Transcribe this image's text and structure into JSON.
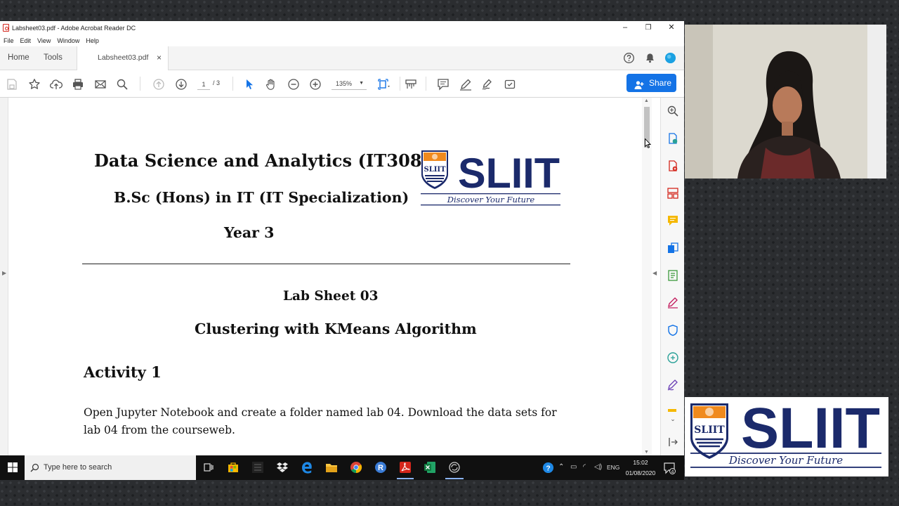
{
  "window": {
    "title": "Labsheet03.pdf - Adobe Acrobat Reader DC",
    "minimize": "–",
    "restore": "❐",
    "close": "✕"
  },
  "menu": [
    "File",
    "Edit",
    "View",
    "Window",
    "Help"
  ],
  "tabs": {
    "home": "Home",
    "tools": "Tools",
    "document": "Labsheet03.pdf",
    "close": "×"
  },
  "toolbar": {
    "page_current": "1",
    "page_total": "/ 3",
    "zoom": "135%",
    "share_label": "Share"
  },
  "document": {
    "course_title": "Data Science and Analytics (IT3080)",
    "degree": "B.Sc (Hons) in IT (IT Specialization)",
    "year": "Year 3",
    "lab_sheet": "Lab Sheet 03",
    "topic": "Clustering with KMeans Algorithm",
    "activity_heading": "Activity 1",
    "activity_text": "Open Jupyter Notebook and create a folder named lab 04. Download the data sets for lab 04 from the courseweb."
  },
  "logo": {
    "name": "SLIIT",
    "tagline": "Discover Your Future",
    "crest": "SLIIT"
  },
  "taskbar": {
    "search_placeholder": "Type here to search",
    "language": "ENG",
    "time": "15:02",
    "date": "01/08/2020",
    "notifications": "4"
  },
  "colors": {
    "accent": "#1473e6",
    "brand_navy": "#1b2a6b",
    "brand_orange": "#f08a1d",
    "pdf_red": "#d4261c"
  }
}
